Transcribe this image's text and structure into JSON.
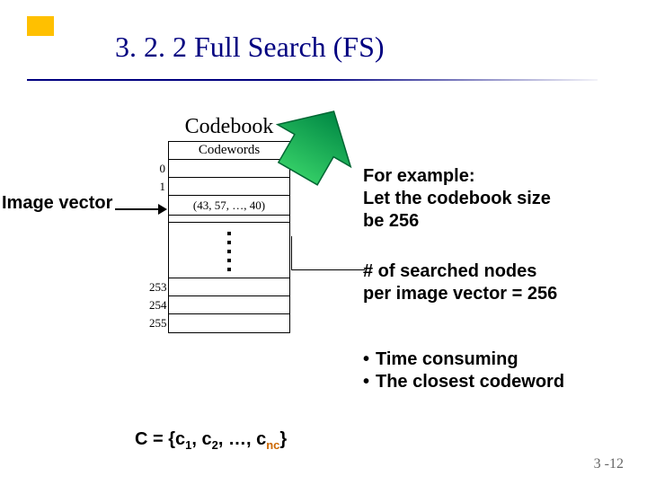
{
  "title": "3. 2. 2  Full Search (FS)",
  "diagram": {
    "codebook_label": "Codebook",
    "codewords_label": "Codewords",
    "visible_indices_top": [
      "0",
      "1"
    ],
    "highlight_row": "(43, 57, …, 40)",
    "visible_indices_bottom": [
      "253",
      "254",
      "255"
    ]
  },
  "image_vector_label": "Image vector",
  "text_blocks": {
    "example": {
      "line1": "For example:",
      "line2": "Let the codebook size",
      "line3": "be 256"
    },
    "searched": {
      "line1": "# of searched nodes",
      "line2": "per image vector = 256"
    },
    "notes": {
      "b1": "Time consuming",
      "b2": "The closest codeword"
    }
  },
  "codeword_set": {
    "prefix": "C = {c",
    "sub1": "1",
    "mid1": ", c",
    "sub2": "2",
    "mid2": ", …, c",
    "subn": "nc",
    "suffix": "}"
  },
  "page_number": "3 -12"
}
